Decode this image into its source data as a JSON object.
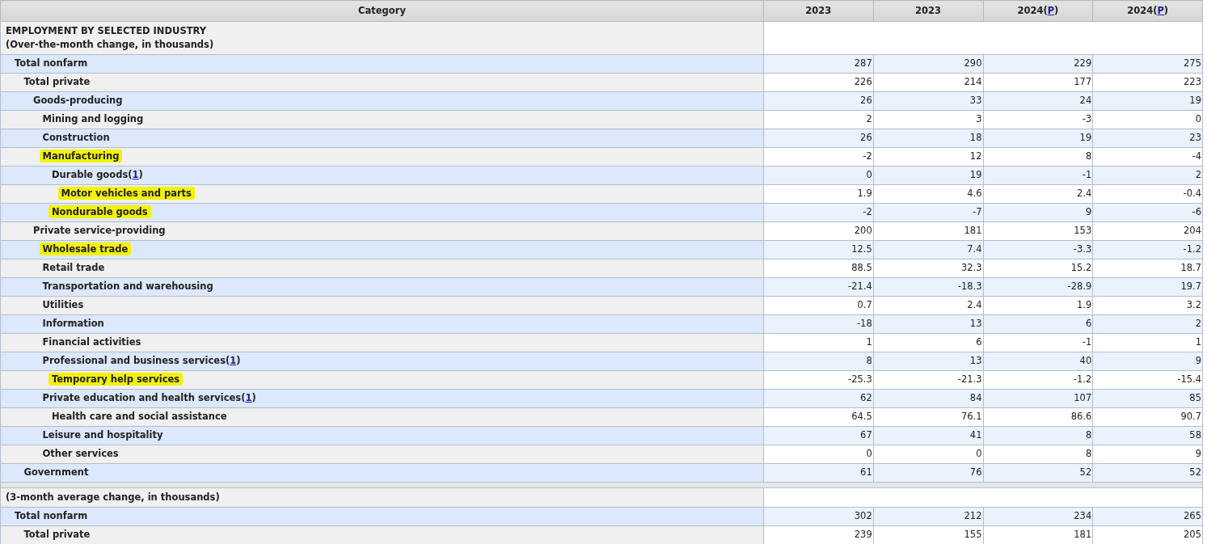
{
  "columns": [
    {
      "label": "Category"
    },
    {
      "label": "2023"
    },
    {
      "label": "2023"
    },
    {
      "label": "2024",
      "note": {
        "prefix": "(",
        "link": "P",
        "suffix": ")"
      }
    },
    {
      "label": "2024",
      "note": {
        "prefix": "(",
        "link": "P",
        "suffix": ")"
      }
    }
  ],
  "sections": [
    {
      "heading_lines": [
        "EMPLOYMENT BY SELECTED INDUSTRY",
        "(Over-the-month change, in thousands)"
      ],
      "rows": [
        {
          "label": "Total nonfarm",
          "highlighted": false,
          "values": [
            "287",
            "290",
            "229",
            "275"
          ],
          "children": [
            {
              "label": "Total private",
              "highlighted": false,
              "values": [
                "226",
                "214",
                "177",
                "223"
              ],
              "children": [
                {
                  "label": "Goods-producing",
                  "highlighted": false,
                  "values": [
                    "26",
                    "33",
                    "24",
                    "19"
                  ],
                  "children": [
                    {
                      "label": "Mining and logging",
                      "highlighted": false,
                      "values": [
                        "2",
                        "3",
                        "-3",
                        "0"
                      ]
                    },
                    {
                      "label": "Construction",
                      "highlighted": false,
                      "values": [
                        "26",
                        "18",
                        "19",
                        "23"
                      ]
                    },
                    {
                      "label": "Manufacturing",
                      "highlighted": true,
                      "values": [
                        "-2",
                        "12",
                        "8",
                        "-4"
                      ],
                      "children": [
                        {
                          "label": "Durable goods",
                          "note": {
                            "prefix": "(",
                            "link": "1",
                            "suffix": ")"
                          },
                          "highlighted": false,
                          "values": [
                            "0",
                            "19",
                            "-1",
                            "2"
                          ],
                          "children": [
                            {
                              "label": "Motor vehicles and parts",
                              "highlighted": true,
                              "values": [
                                "1.9",
                                "4.6",
                                "2.4",
                                "-0.4"
                              ]
                            }
                          ]
                        },
                        {
                          "label": "Nondurable goods",
                          "highlighted": true,
                          "values": [
                            "-2",
                            "-7",
                            "9",
                            "-6"
                          ]
                        }
                      ]
                    }
                  ]
                },
                {
                  "label": "Private service-providing",
                  "highlighted": false,
                  "values": [
                    "200",
                    "181",
                    "153",
                    "204"
                  ],
                  "children": [
                    {
                      "label": "Wholesale trade",
                      "highlighted": true,
                      "values": [
                        "12.5",
                        "7.4",
                        "-3.3",
                        "-1.2"
                      ]
                    },
                    {
                      "label": "Retail trade",
                      "highlighted": false,
                      "values": [
                        "88.5",
                        "32.3",
                        "15.2",
                        "18.7"
                      ]
                    },
                    {
                      "label": "Transportation and warehousing",
                      "highlighted": false,
                      "values": [
                        "-21.4",
                        "-18.3",
                        "-28.9",
                        "19.7"
                      ]
                    },
                    {
                      "label": "Utilities",
                      "highlighted": false,
                      "values": [
                        "0.7",
                        "2.4",
                        "1.9",
                        "3.2"
                      ]
                    },
                    {
                      "label": "Information",
                      "highlighted": false,
                      "values": [
                        "-18",
                        "13",
                        "6",
                        "2"
                      ]
                    },
                    {
                      "label": "Financial activities",
                      "highlighted": false,
                      "values": [
                        "1",
                        "6",
                        "-1",
                        "1"
                      ]
                    },
                    {
                      "label": "Professional and business services",
                      "note": {
                        "prefix": "(",
                        "link": "1",
                        "suffix": ")"
                      },
                      "highlighted": false,
                      "values": [
                        "8",
                        "13",
                        "40",
                        "9"
                      ],
                      "children": [
                        {
                          "label": "Temporary help services",
                          "highlighted": true,
                          "values": [
                            "-25.3",
                            "-21.3",
                            "-1.2",
                            "-15.4"
                          ]
                        }
                      ]
                    },
                    {
                      "label": "Private education and health services",
                      "note": {
                        "prefix": "(",
                        "link": "1",
                        "suffix": ")"
                      },
                      "highlighted": false,
                      "values": [
                        "62",
                        "84",
                        "107",
                        "85"
                      ],
                      "children": [
                        {
                          "label": "Health care and social assistance",
                          "highlighted": false,
                          "values": [
                            "64.5",
                            "76.1",
                            "86.6",
                            "90.7"
                          ]
                        }
                      ]
                    },
                    {
                      "label": "Leisure and hospitality",
                      "highlighted": false,
                      "values": [
                        "67",
                        "41",
                        "8",
                        "58"
                      ]
                    },
                    {
                      "label": "Other services",
                      "highlighted": false,
                      "values": [
                        "0",
                        "0",
                        "8",
                        "9"
                      ]
                    }
                  ]
                }
              ]
            },
            {
              "label": "Government",
              "highlighted": false,
              "values": [
                "61",
                "76",
                "52",
                "52"
              ]
            }
          ]
        }
      ]
    },
    {
      "heading_lines": [
        "(3-month average change, in thousands)"
      ],
      "rows": [
        {
          "label": "Total nonfarm",
          "highlighted": false,
          "values": [
            "302",
            "212",
            "234",
            "265"
          ],
          "children": [
            {
              "label": "Total private",
              "highlighted": false,
              "values": [
                "239",
                "155",
                "181",
                "205"
              ]
            }
          ]
        }
      ]
    }
  ]
}
